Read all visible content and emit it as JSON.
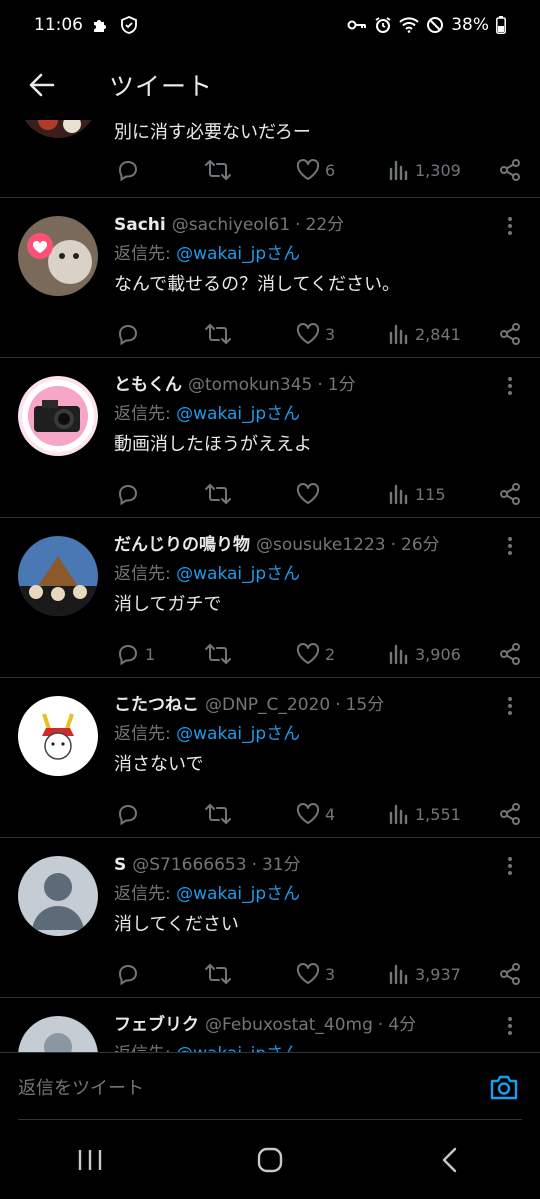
{
  "status": {
    "time": "11:06",
    "battery": "38%"
  },
  "header": {
    "title": "ツイート"
  },
  "first_tweet": {
    "text": "別に消す必要ないだろー",
    "likes": "6",
    "views": "1,309"
  },
  "tweets": [
    {
      "name": "Sachi",
      "handle": "@sachiyeol61",
      "time": "22分",
      "reply_prefix": "返信先:",
      "reply_to": "@wakai_jpさん",
      "text": "なんで載せるの？消してください。",
      "replies": "",
      "likes": "3",
      "views": "2,841"
    },
    {
      "name": "ともくん",
      "handle": "@tomokun345",
      "time": "1分",
      "reply_prefix": "返信先:",
      "reply_to": "@wakai_jpさん",
      "text": "動画消したほうがええよ",
      "replies": "",
      "likes": "",
      "views": "115"
    },
    {
      "name": "だんじりの鳴り物",
      "handle": "@sousuke1223",
      "time": "26分",
      "reply_prefix": "返信先:",
      "reply_to": "@wakai_jpさん",
      "text": "消してガチで",
      "replies": "1",
      "likes": "2",
      "views": "3,906"
    },
    {
      "name": "こたつねこ",
      "handle": "@DNP_C_2020",
      "time": "15分",
      "reply_prefix": "返信先:",
      "reply_to": "@wakai_jpさん",
      "text": "消さないで",
      "replies": "",
      "likes": "4",
      "views": "1,551"
    },
    {
      "name": "S",
      "handle": "@S71666653",
      "time": "31分",
      "reply_prefix": "返信先:",
      "reply_to": "@wakai_jpさん",
      "text": "消してください",
      "replies": "",
      "likes": "3",
      "views": "3,937"
    },
    {
      "name": "フェブリク",
      "handle": "@Febuxostat_40mg",
      "time": "4分",
      "reply_prefix": "返信先:",
      "reply_to": "@wakai_jpさん",
      "text": "",
      "replies": "",
      "likes": "",
      "views": ""
    }
  ],
  "compose": {
    "placeholder": "返信をツイート"
  },
  "colors": {
    "background": "#000000",
    "accent": "#1d9bf0",
    "muted": "#71767b",
    "divider": "#2f3336"
  },
  "icons": [
    "back-arrow-icon",
    "reply-icon",
    "retweet-icon",
    "like-icon",
    "views-icon",
    "share-icon",
    "more-icon",
    "camera-icon",
    "recents-icon",
    "home-icon",
    "back-nav-icon"
  ]
}
